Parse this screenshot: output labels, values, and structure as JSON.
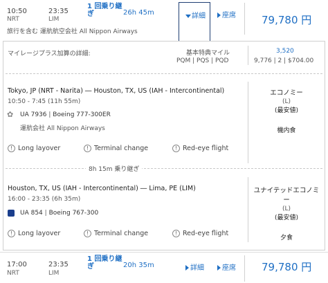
{
  "flight1": {
    "depart_time": "10:50",
    "depart_code": "NRT",
    "arrive_time": "23:35",
    "arrive_code": "LIM",
    "stops": "1 回乗り継ぎ",
    "duration": "26h 45m",
    "details_label": "詳細",
    "seats_label": "座席",
    "price": "79,780 円",
    "operator_note": "旅行を含む 運航航空会社 All Nippon Airways"
  },
  "details": {
    "mileage_label": "マイレージプラス加算の詳細:",
    "award_header": "基本特典マイル",
    "award_codes": "PQM | PQS | PQD",
    "award_value": "3,520",
    "award_breakdown": "9,776 | 2 | $704.00"
  },
  "segment1": {
    "route": "Tokyo, JP (NRT - Narita) ― Houston, TX, US (IAH - Intercontinental)",
    "times": "10:50 - 7:45 (11h 55m)",
    "flight": "UA 7936",
    "aircraft": "Boeing 777-300ER",
    "operator": "運航会社 All Nippon Airways",
    "cabin": "エコノミー",
    "fare_class": "(L)",
    "fare_note": "(最安値)",
    "meal": "機内食",
    "notes": [
      "Long layover",
      "Terminal change",
      "Red-eye flight"
    ]
  },
  "layover": {
    "label": "8h 15m 乗り継ぎ"
  },
  "segment2": {
    "route": "Houston, TX, US (IAH - Intercontinental) ― Lima, PE (LIM)",
    "times": "16:00 - 23:35 (6h 35m)",
    "flight": "UA 854",
    "aircraft": "Boeing 767-300",
    "cabin": "ユナイテッドエコノミー",
    "fare_class": "(L)",
    "fare_note": "(最安値)",
    "meal": "夕食",
    "notes": [
      "Long layover",
      "Terminal change",
      "Red-eye flight"
    ]
  },
  "flight2": {
    "depart_time": "17:00",
    "depart_code": "NRT",
    "arrive_time": "23:35",
    "arrive_code": "LIM",
    "stops": "1 回乗り継ぎ",
    "duration": "20h 35m",
    "details_label": "詳細",
    "seats_label": "座席",
    "price": "79,780 円"
  }
}
